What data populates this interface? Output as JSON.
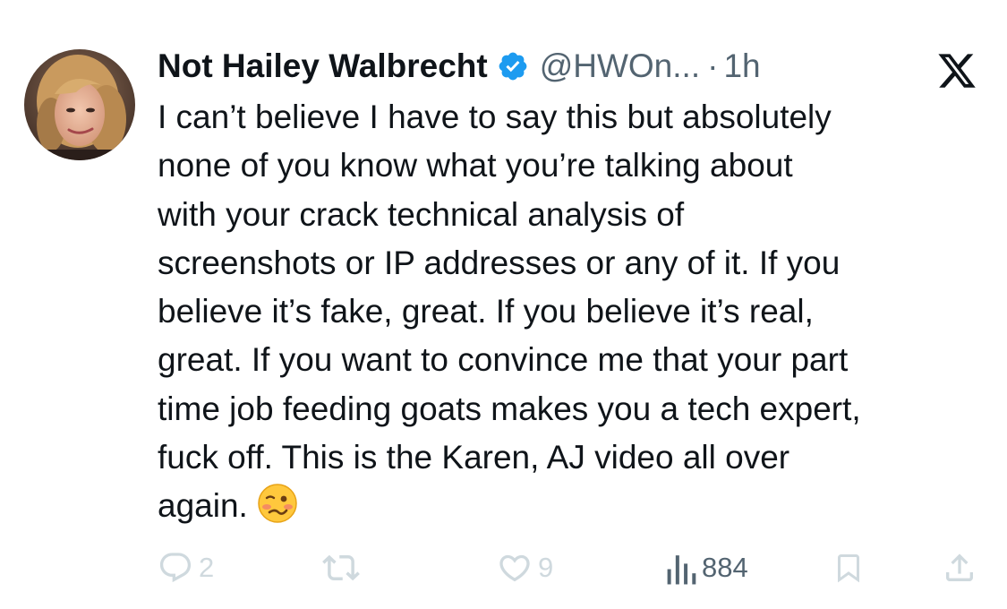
{
  "tweet": {
    "author": {
      "display_name": "Not Hailey Walbrecht",
      "handle": "@HWOn...",
      "separator": "·",
      "time": "1h",
      "verified": true,
      "verified_icon": "verified-badge-icon",
      "avatar": "profile-photo"
    },
    "platform_icon": "x-logo-icon",
    "text_lines": [
      "I can’t believe I have to say this but absolutely",
      "none of you know what you’re talking about",
      "with your crack technical analysis of",
      "screenshots or IP addresses or any of it. If you",
      "believe it’s fake, great. If you believe it’s real,",
      "great. If you want to convince me that your part",
      "time job feeding goats makes you a tech expert,",
      "fuck off. This is the Karen, AJ video all over",
      "again."
    ],
    "trailing_emoji": "woozy-face-emoji",
    "actions": {
      "replies": {
        "icon": "reply-icon",
        "count": "2"
      },
      "retweets": {
        "icon": "retweet-icon",
        "count": ""
      },
      "likes": {
        "icon": "heart-icon",
        "count": "9"
      },
      "views": {
        "icon": "views-chart-icon",
        "count": "884"
      },
      "bookmark": {
        "icon": "bookmark-icon"
      },
      "share": {
        "icon": "share-icon"
      }
    },
    "colors": {
      "text": "#0f1419",
      "secondary": "#536471",
      "verified_blue": "#1d9bf0",
      "faded_action": "#cfd9de"
    }
  }
}
